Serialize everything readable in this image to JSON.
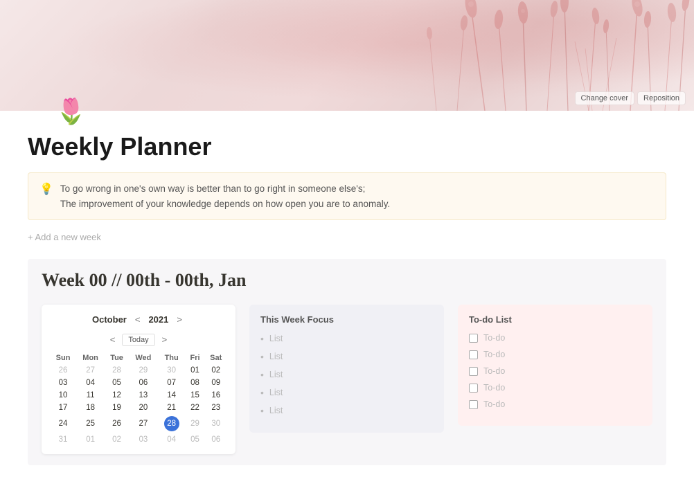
{
  "cover": {
    "change_cover_label": "Change cover",
    "reposition_label": "Reposition"
  },
  "page": {
    "icon": "🌷",
    "title": "Weekly Planner"
  },
  "quote": {
    "icon": "💡",
    "line1": "To go wrong in one's own way is better than to go right in someone else's;",
    "line2": "The improvement of your knowledge depends on how open you are to anomaly."
  },
  "add_week": {
    "label": "+ Add a new week"
  },
  "week": {
    "title": "Week 00 // 00th - 00th, Jan"
  },
  "calendar": {
    "month": "October",
    "year": "2021",
    "prev": "<",
    "next": ">",
    "prev_nav": "<",
    "today_label": "Today",
    "next_nav": ">",
    "days": [
      "Sun",
      "Mon",
      "Tue",
      "Wed",
      "Thu",
      "Fri",
      "Sat"
    ],
    "rows": [
      [
        "26",
        "27",
        "28",
        "29",
        "30",
        "01",
        "02"
      ],
      [
        "03",
        "04",
        "05",
        "06",
        "07",
        "08",
        "09"
      ],
      [
        "10",
        "11",
        "12",
        "13",
        "14",
        "15",
        "16"
      ],
      [
        "17",
        "18",
        "19",
        "20",
        "21",
        "22",
        "23"
      ],
      [
        "24",
        "25",
        "26",
        "27",
        "28",
        "29",
        "30"
      ],
      [
        "31",
        "01",
        "02",
        "03",
        "04",
        "05",
        "06"
      ]
    ],
    "other_month_start": [
      "26",
      "27",
      "28",
      "29",
      "30"
    ],
    "other_month_end_row5": [
      "29",
      "30"
    ],
    "other_month_end_row6": [
      "01",
      "02",
      "03",
      "04",
      "05",
      "06"
    ],
    "today_date": "28"
  },
  "focus": {
    "title": "This Week Focus",
    "items": [
      {
        "label": "List"
      },
      {
        "label": "List"
      },
      {
        "label": "List"
      },
      {
        "label": "List"
      },
      {
        "label": "List"
      }
    ]
  },
  "todo": {
    "title": "To-do List",
    "items": [
      {
        "label": "To-do"
      },
      {
        "label": "To-do"
      },
      {
        "label": "To-do"
      },
      {
        "label": "To-do"
      },
      {
        "label": "To-do"
      }
    ]
  }
}
